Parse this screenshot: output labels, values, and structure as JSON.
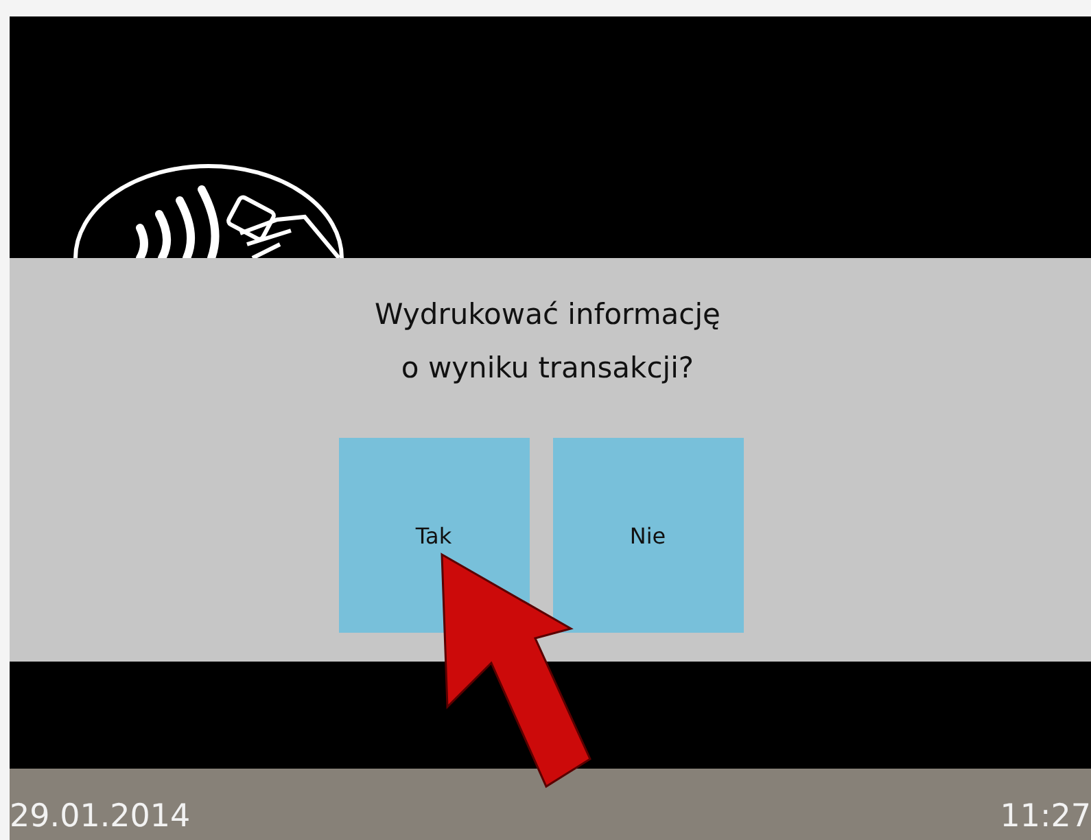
{
  "dialog": {
    "question": "Wydrukować informację o wyniku transakcji?",
    "buttons": [
      {
        "label": "Tak"
      },
      {
        "label": "Nie"
      }
    ]
  },
  "status_bar": {
    "date": "29.01.2014",
    "time": "11:27"
  }
}
